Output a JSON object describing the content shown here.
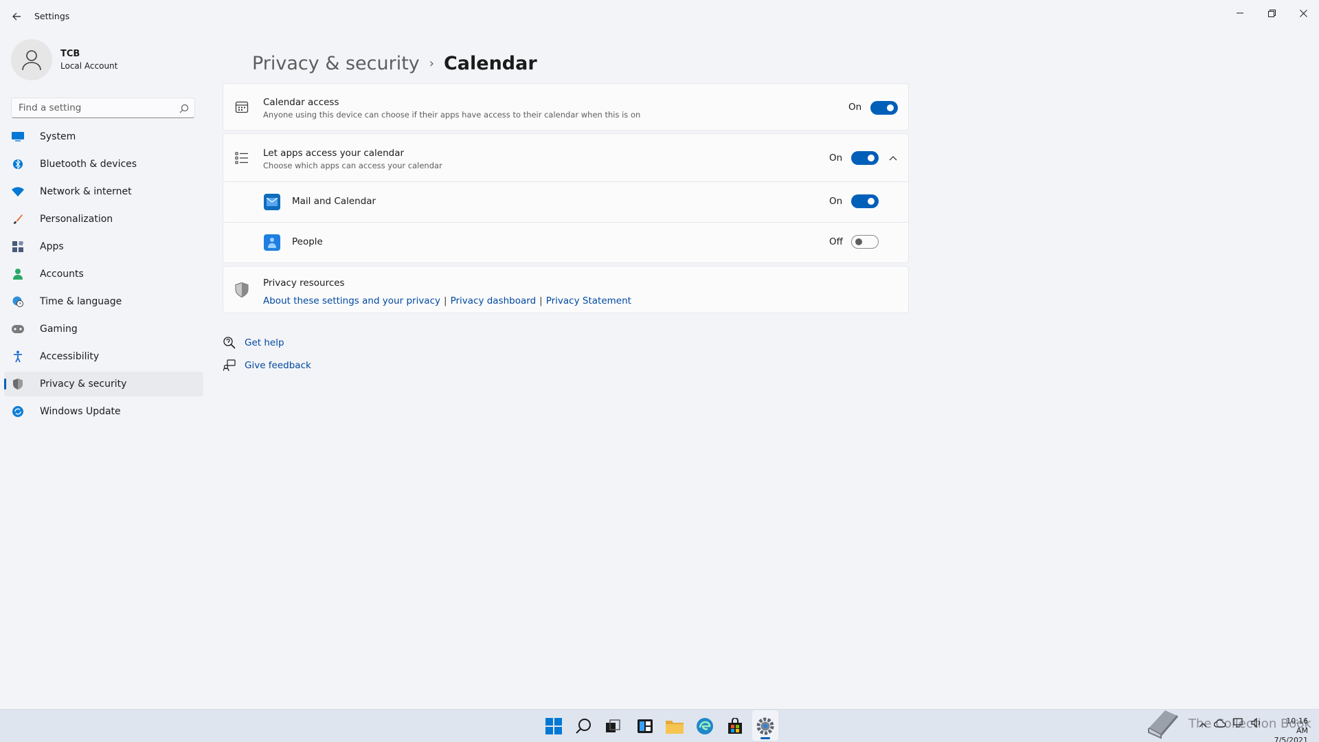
{
  "window": {
    "title": "Settings"
  },
  "profile": {
    "name": "TCB",
    "account_type": "Local Account"
  },
  "search": {
    "placeholder": "Find a setting"
  },
  "nav": {
    "items": [
      {
        "label": "System",
        "icon": "system-icon",
        "color": "#0078d4"
      },
      {
        "label": "Bluetooth & devices",
        "icon": "bluetooth-icon",
        "color": "#0078d4"
      },
      {
        "label": "Network & internet",
        "icon": "network-icon",
        "color": "#0078d4"
      },
      {
        "label": "Personalization",
        "icon": "brush-icon",
        "color": "#e36a2c"
      },
      {
        "label": "Apps",
        "icon": "apps-icon",
        "color": "#4a5b7a"
      },
      {
        "label": "Accounts",
        "icon": "accounts-icon",
        "color": "#29a869"
      },
      {
        "label": "Time & language",
        "icon": "globe-clock-icon",
        "color": "#2f8fd8"
      },
      {
        "label": "Gaming",
        "icon": "controller-icon",
        "color": "#7a7a7a"
      },
      {
        "label": "Accessibility",
        "icon": "accessibility-icon",
        "color": "#1f6fd1"
      },
      {
        "label": "Privacy & security",
        "icon": "shield-icon",
        "color": "#6b6b6b",
        "selected": true
      },
      {
        "label": "Windows Update",
        "icon": "update-icon",
        "color": "#0f7ed8"
      }
    ]
  },
  "breadcrumb": {
    "parent": "Privacy & security",
    "separator": "›",
    "current": "Calendar"
  },
  "calendar_access": {
    "title": "Calendar access",
    "description": "Anyone using this device can choose if their apps have access to their calendar when this is on",
    "state_label": "On",
    "on": true
  },
  "app_access": {
    "title": "Let apps access your calendar",
    "description": "Choose which apps can access your calendar",
    "state_label": "On",
    "on": true,
    "apps": [
      {
        "name": "Mail and Calendar",
        "state_label": "On",
        "on": true,
        "tile_color": "#0f6cbd"
      },
      {
        "name": "People",
        "state_label": "Off",
        "on": false,
        "tile_color": "#1f7fe0"
      }
    ]
  },
  "privacy_resources": {
    "title": "Privacy resources",
    "links": [
      "About these settings and your privacy",
      "Privacy dashboard",
      "Privacy Statement"
    ],
    "separator": "|"
  },
  "help": {
    "get_help": "Get help",
    "give_feedback": "Give feedback"
  },
  "taskbar": {
    "watermark": "The Collection Book",
    "time": "10:16 AM",
    "date": "7/5/2021"
  },
  "colors": {
    "accent": "#005fb8",
    "link": "#0049a0"
  }
}
